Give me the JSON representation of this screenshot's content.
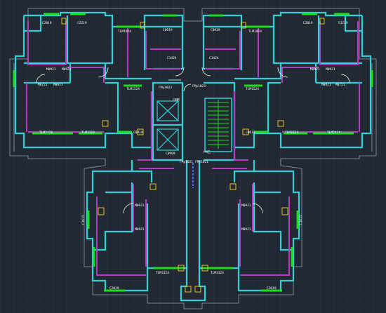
{
  "colors": {
    "background": "#222933",
    "grid": "#2c3440",
    "wall": "#2fd0d8",
    "partition": "#b43cc4",
    "window": "#18e018",
    "door": "#ffffff",
    "annotation": "#e6c020",
    "text": "#ffffff",
    "outline": "#8aa0b8"
  },
  "labels": {
    "top_left_windows": [
      "C2019",
      "C2219"
    ],
    "top_right_windows": [
      "C2019",
      "C2219"
    ],
    "upper_balcony_left": "TLM1824",
    "upper_balcony_right": "TLM1824",
    "kitchen_window_left": "C0919",
    "kitchen_window_right": "C0919",
    "kitchen_label_left": "C1424",
    "kitchen_label_right": "C1424",
    "doors_left_upper": [
      "M0921",
      "M0921"
    ],
    "doors_right_upper": [
      "M0921",
      "M0921"
    ],
    "small_door_left": "M0721",
    "small_door_right": "M0721",
    "mid_door_left": "M0921",
    "mid_door_right": "M0921",
    "balcony_mid_left": "TLM1524",
    "balcony_mid_right": "TLM1524",
    "living_left": "TLM2424",
    "living_left2": "TLM3324",
    "living_right": "TLM3324",
    "living_right2": "TLM2424",
    "window_low_left": "C0919",
    "window_low_right": "C0919",
    "fm_left": "FMy1023",
    "fm_right": "FMy1023",
    "fm_stair_top": "FM甲",
    "fm_stair_bottom": "FM乙",
    "fm_lower_left": "FMy1021",
    "fm_lower_right": "FMy1021",
    "lower_doors_left": [
      "M0921",
      "M0921"
    ],
    "lower_doors_right": [
      "M0921",
      "M0921"
    ],
    "lower_side_left": "C1615",
    "lower_side_right": "C1615",
    "lower_balcony_left": "TLM3324",
    "lower_balcony_right": "TLM3324",
    "bottom_window_left": "C2019",
    "bottom_window_right": "C2019",
    "shaft_label": "C0909"
  }
}
